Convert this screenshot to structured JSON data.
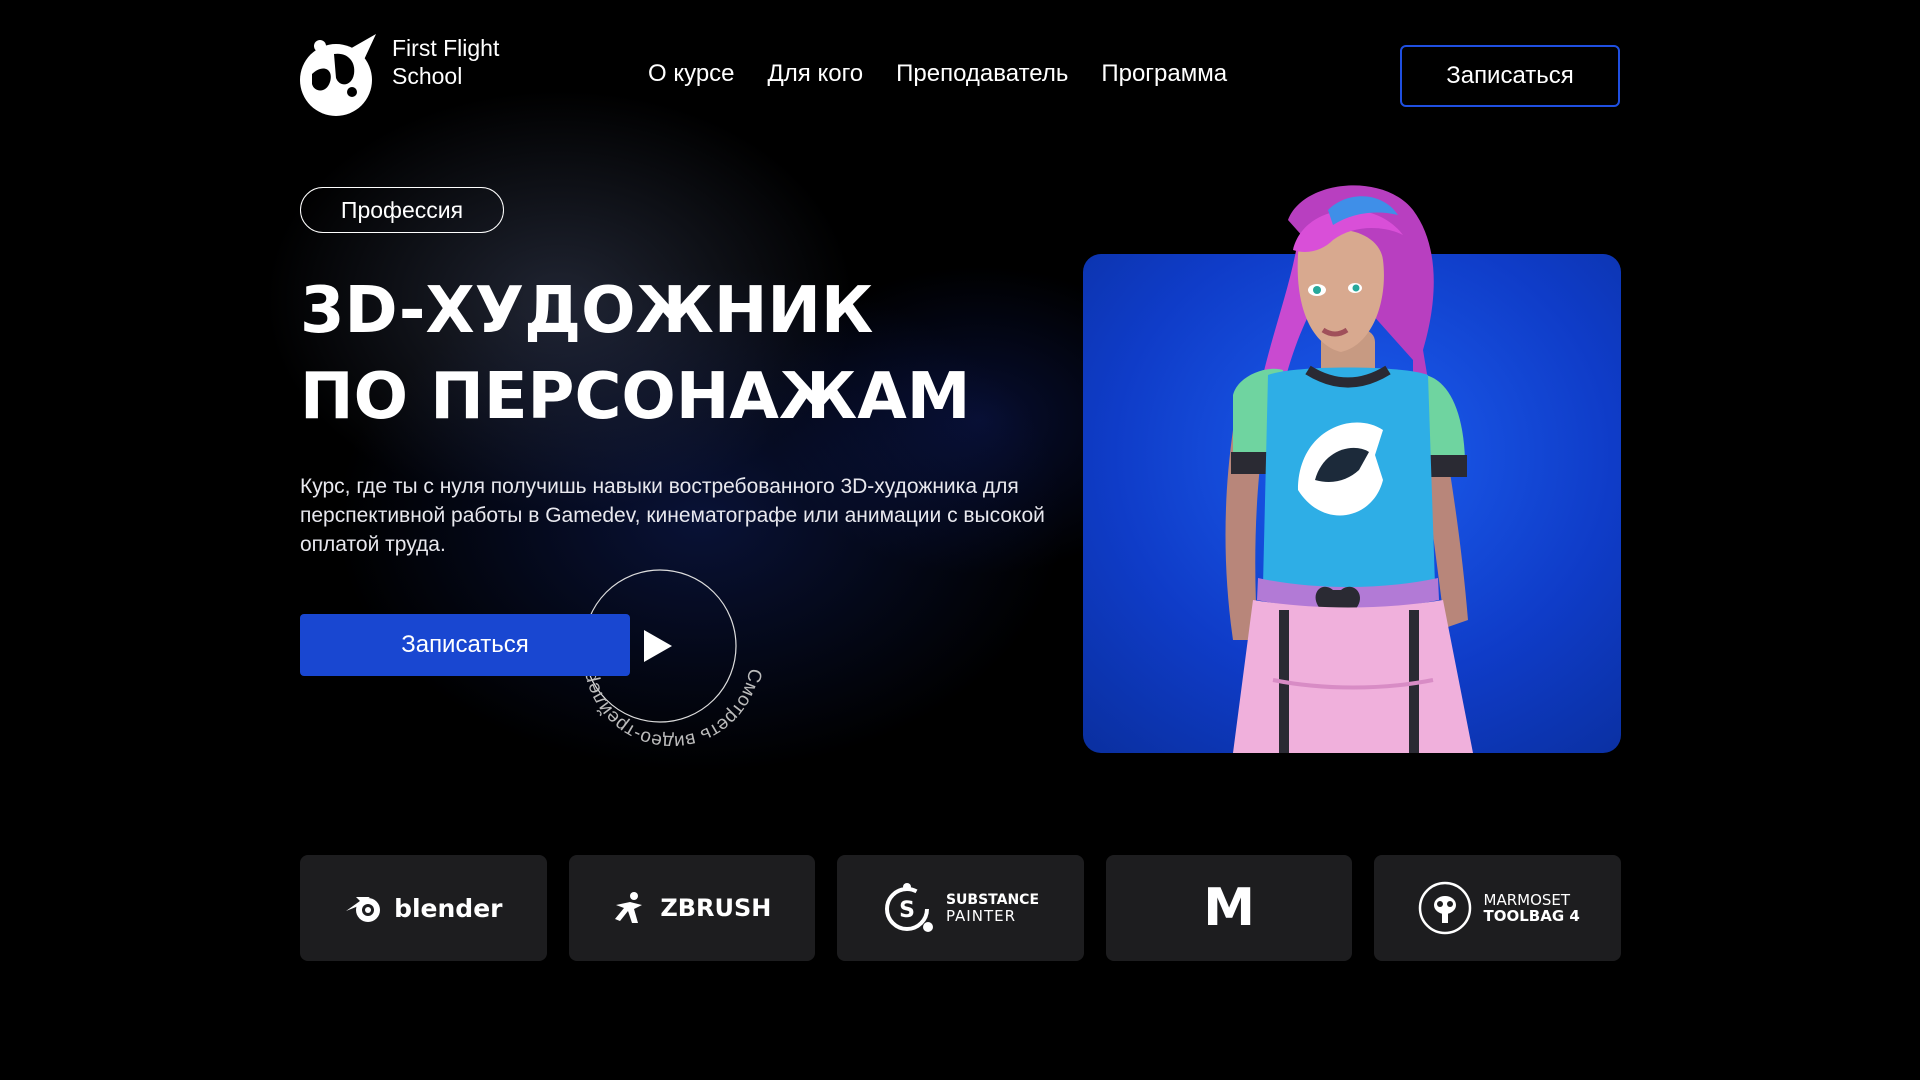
{
  "brand": {
    "line1": "First Flight",
    "line2": "School"
  },
  "nav": [
    {
      "label": "О курсе"
    },
    {
      "label": "Для кого"
    },
    {
      "label": "Преподаватель"
    },
    {
      "label": "Программа"
    }
  ],
  "header": {
    "cta_label": "Записаться"
  },
  "hero": {
    "badge": "Профессия",
    "title_line1": "3D-ХУДОЖНИК",
    "title_line2": "ПО ПЕРСОНАЖАМ",
    "description": "Курс, где ты с нуля получишь навыки востребованного 3D-художника для перспективной работы в Gamedev, кинематографе или анимации с высокой оплатой труда.",
    "cta_label": "Записаться",
    "video_label": "Смотреть видео-трейлер"
  },
  "tools": [
    {
      "name": "blender",
      "icon": "blender-logo-icon"
    },
    {
      "name": "ZBRUSH",
      "icon": "zbrush-logo-icon"
    },
    {
      "line1": "SUBSTANCE",
      "line2": "PAINTER",
      "icon": "substance-painter-logo-icon"
    },
    {
      "name": "M",
      "icon": "maya-logo-icon"
    },
    {
      "line1": "MARMOSET",
      "line2": "TOOLBAG 4",
      "icon": "marmoset-logo-icon"
    }
  ],
  "colors": {
    "accent": "#1947d1",
    "outline": "#1f4fe0",
    "card_blue": "#1c5ef0",
    "tile": "#1d1d1f"
  }
}
